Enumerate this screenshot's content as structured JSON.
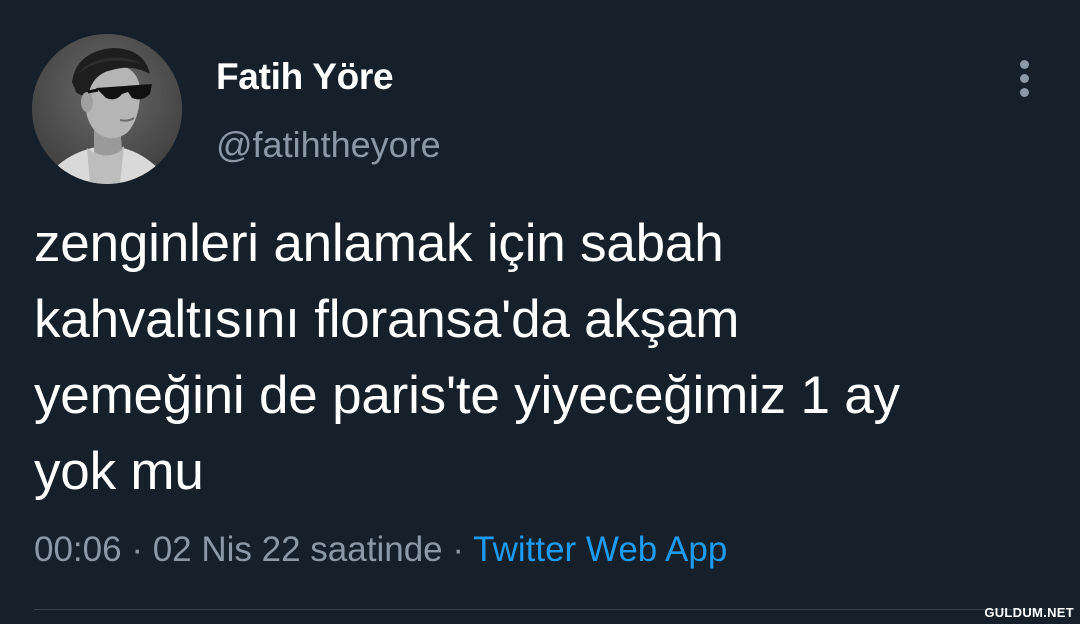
{
  "author": {
    "display_name": "Fatih Yöre",
    "handle": "@fatihtheyore",
    "avatar_icon": "profile-photo"
  },
  "tweet": {
    "text_lines": [
      "zenginleri anlamak için sabah",
      "kahvaltısını floransa'da akşam",
      "yemeğini de paris'te yiyeceğimiz 1 ay",
      "yok mu"
    ]
  },
  "meta": {
    "time": "00:06",
    "separator": "·",
    "date": "02 Nis 22 saatinde",
    "source": "Twitter Web App"
  },
  "more_icon": "more-vertical-icon",
  "watermark": "GULDUM.NET",
  "colors": {
    "background": "#15202b",
    "text": "#ffffff",
    "secondary": "#8b98a5",
    "link": "#1d9bf0",
    "divider": "#38444d"
  }
}
